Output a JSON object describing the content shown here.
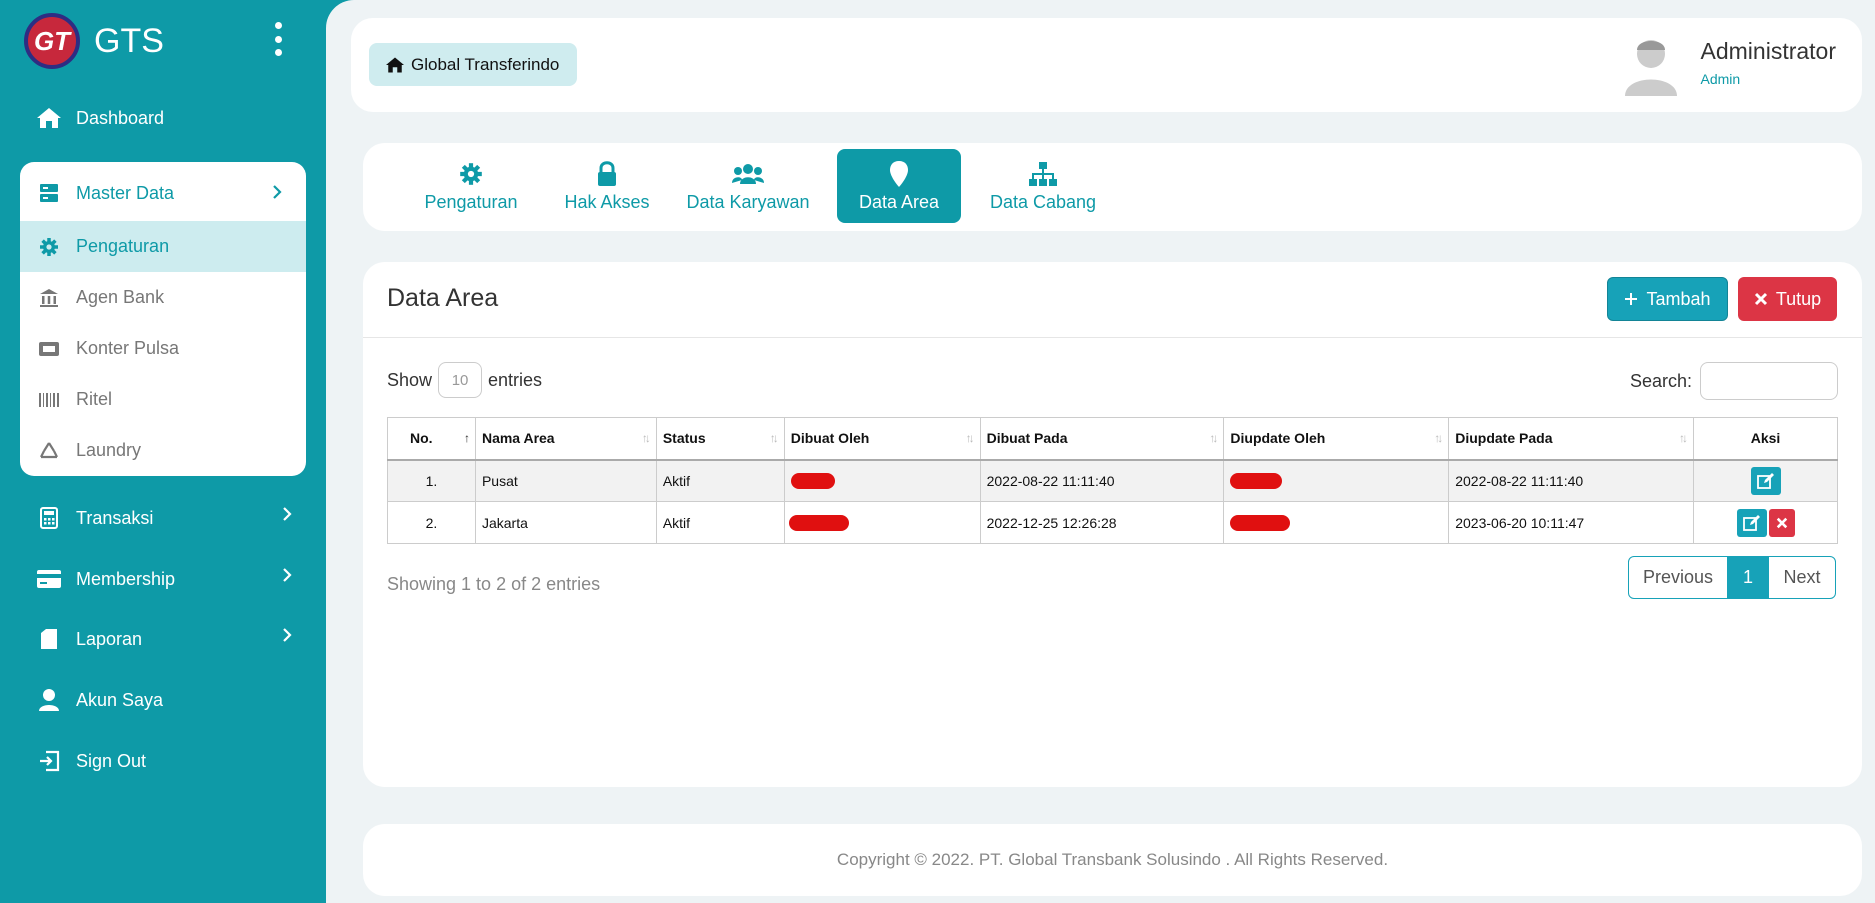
{
  "brand": {
    "logo_text": "GT",
    "name": "GTS"
  },
  "sidebar": {
    "dashboard": "Dashboard",
    "master_data": "Master Data",
    "sub_items": [
      "Pengaturan",
      "Agen Bank",
      "Konter Pulsa",
      "Ritel",
      "Laundry"
    ],
    "transaksi": "Transaksi",
    "membership": "Membership",
    "laporan": "Laporan",
    "akun_saya": "Akun Saya",
    "sign_out": "Sign Out"
  },
  "header": {
    "company": "Global Transferindo",
    "user_name": "Administrator",
    "user_role": "Admin"
  },
  "tabs": [
    "Pengaturan",
    "Hak Akses",
    "Data Karyawan",
    "Data Area",
    "Data Cabang"
  ],
  "active_tab": "Data Area",
  "card": {
    "title": "Data Area",
    "tambah_label": "Tambah",
    "tutup_label": "Tutup",
    "show_label": "Show",
    "entries_label": "entries",
    "page_length": "10",
    "search_label": "Search:",
    "search_value": ""
  },
  "table": {
    "columns": [
      "No.",
      "Nama Area",
      "Status",
      "Dibuat Oleh",
      "Dibuat Pada",
      "Diupdate Oleh",
      "Diupdate Pada",
      "Aksi"
    ],
    "rows": [
      {
        "no": "1.",
        "nama_area": "Pusat",
        "status": "Aktif",
        "dibuat_pada": "2022-08-22 11:11:40",
        "diupdate_pada": "2022-08-22 11:11:40"
      },
      {
        "no": "2.",
        "nama_area": "Jakarta",
        "status": "Aktif",
        "dibuat_pada": "2022-12-25 12:26:28",
        "diupdate_pada": "2023-06-20 10:11:47"
      }
    ]
  },
  "pagination": {
    "info": "Showing 1 to 2 of 2 entries",
    "previous": "Previous",
    "current": "1",
    "next": "Next"
  },
  "footer": {
    "copyright": "Copyright © 2022. PT. Global Transbank Solusindo . All Rights Reserved."
  },
  "colors": {
    "primary": "#0e9aa7",
    "danger": "#dc3545",
    "redaction": "#e01010"
  }
}
